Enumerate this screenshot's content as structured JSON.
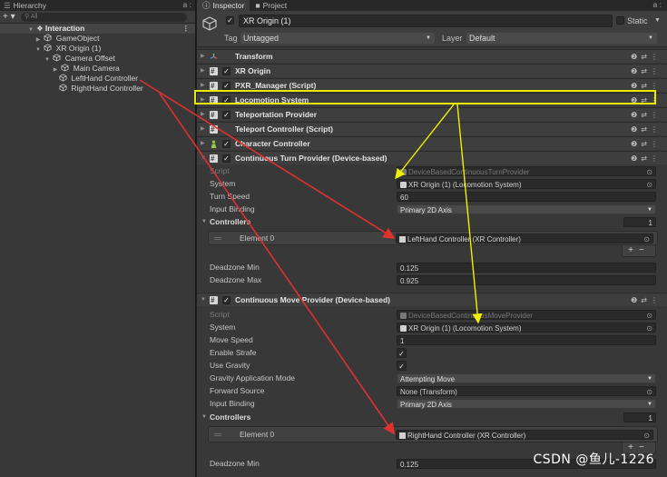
{
  "hierarchy": {
    "tab_label": "Hierarchy",
    "tab_right": "a :",
    "search_placeholder": "All",
    "plus_label": "+ ▾",
    "items": [
      {
        "label": "Interaction"
      },
      {
        "label": "GameObject"
      },
      {
        "label": "XR Origin (1)"
      },
      {
        "label": "Camera Offset"
      },
      {
        "label": "Main Camera"
      },
      {
        "label": "LeftHand Controller"
      },
      {
        "label": "RightHand Controller"
      }
    ]
  },
  "inspector": {
    "tabs": [
      {
        "label": "Inspector"
      },
      {
        "label": "Project"
      }
    ],
    "tab_right": "a :",
    "object": {
      "name": "XR Origin (1)",
      "static_label": "Static",
      "tag_label": "Tag",
      "tag_value": "Untagged",
      "layer_label": "Layer",
      "layer_value": "Default"
    },
    "components": [
      {
        "name": "Transform"
      },
      {
        "name": "XR Origin"
      },
      {
        "name": "PXR_Manager (Script)"
      },
      {
        "name": "Locomotion System"
      },
      {
        "name": "Teleportation Provider"
      },
      {
        "name": "Teleport Controller (Script)"
      },
      {
        "name": "Character Controller"
      },
      {
        "name": "Continuous Turn Provider (Device-based)"
      }
    ],
    "turn_provider": {
      "script_label": "Script",
      "script_value": "DeviceBasedContinuousTurnProvider",
      "system_label": "System",
      "system_value": "XR Origin (1) (Locomotion System)",
      "turn_speed_label": "Turn Speed",
      "turn_speed_value": "60",
      "input_binding_label": "Input Binding",
      "input_binding_value": "Primary 2D Axis",
      "controllers_label": "Controllers",
      "controllers_size": "1",
      "element_label": "Element 0",
      "element_value": "LeftHand Controller (XR Controller)",
      "deadzone_min_label": "Deadzone Min",
      "deadzone_min_value": "0.125",
      "deadzone_max_label": "Deadzone Max",
      "deadzone_max_value": "0.925"
    },
    "move_provider": {
      "name": "Continuous Move Provider (Device-based)",
      "script_label": "Script",
      "script_value": "DeviceBasedContinuousMoveProvider",
      "system_label": "System",
      "system_value": "XR Origin (1) (Locomotion System)",
      "move_speed_label": "Move Speed",
      "move_speed_value": "1",
      "enable_strafe_label": "Enable Strafe",
      "use_gravity_label": "Use Gravity",
      "gravity_mode_label": "Gravity Application Mode",
      "gravity_mode_value": "Attempting Move",
      "forward_source_label": "Forward Source",
      "forward_source_value": "None (Transform)",
      "input_binding_label": "Input Binding",
      "input_binding_value": "Primary 2D Axis",
      "controllers_label": "Controllers",
      "controllers_size": "1",
      "element_label": "Element 0",
      "element_value": "RightHand Controller (XR Controller)",
      "deadzone_min_label": "Deadzone Min",
      "deadzone_min_value": "0.125"
    }
  },
  "watermark": "CSDN @鱼儿-1226",
  "colors": {
    "highlight": "#e8e800",
    "arrow_red": "#e03030",
    "arrow_yellow": "#f0f000"
  }
}
